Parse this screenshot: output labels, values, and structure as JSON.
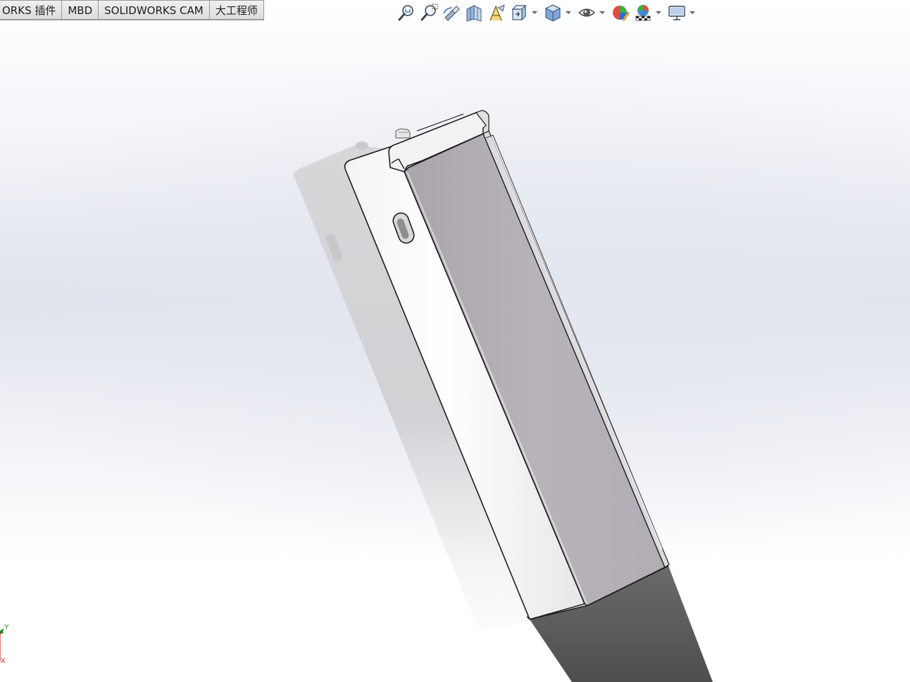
{
  "command_manager": {
    "tabs": [
      {
        "label": "ORKS 插件"
      },
      {
        "label": "MBD"
      },
      {
        "label": "SOLIDWORKS CAM"
      },
      {
        "label": "大工程师"
      }
    ]
  },
  "view_toolbar": {
    "buttons": [
      {
        "icon": "zoom-to-fit-icon"
      },
      {
        "icon": "zoom-to-area-icon"
      },
      {
        "icon": "previous-view-icon"
      },
      {
        "icon": "section-view-icon"
      },
      {
        "icon": "dynamic-annotation-views-icon"
      },
      {
        "icon": "view-orientation-icon"
      },
      {
        "icon": "display-style-icon"
      },
      {
        "icon": "hide-show-items-icon"
      },
      {
        "icon": "edit-appearance-icon"
      },
      {
        "icon": "apply-scene-icon"
      },
      {
        "icon": "view-settings-icon"
      }
    ]
  },
  "triad": {
    "y_label": "Y",
    "x_label": "X",
    "y_color": "#1a8a1a",
    "x_color": "#d02020"
  },
  "colors": {
    "viewport_top": "#ffffff",
    "viewport_band": "#dfe2ec",
    "part_face_light": "#fbfbfb",
    "part_face_side": "#b6b1b8",
    "part_shadow": "#5a5a5a"
  }
}
